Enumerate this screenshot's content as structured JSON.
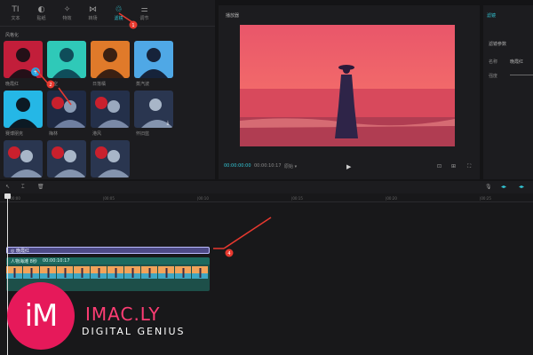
{
  "toolbar": {
    "tabs": [
      {
        "icon": "TI",
        "label": "文本"
      },
      {
        "icon": "◐",
        "label": "贴纸"
      },
      {
        "icon": "✧",
        "label": "特效"
      },
      {
        "icon": "⋈",
        "label": "转场"
      },
      {
        "icon": "♲",
        "label": "滤镜",
        "active": true
      },
      {
        "icon": "⚌",
        "label": "调节"
      }
    ]
  },
  "effects_panel": {
    "category": "风格化",
    "items": [
      {
        "label": "晚霞红"
      },
      {
        "label": "晴空"
      },
      {
        "label": "日落橘"
      },
      {
        "label": "蒸汽波"
      },
      {
        "label": "赛博朋克"
      },
      {
        "label": "梅林"
      },
      {
        "label": "港风"
      },
      {
        "label": "怀旧蓝"
      },
      {
        "label": ""
      },
      {
        "label": ""
      },
      {
        "label": ""
      }
    ]
  },
  "player": {
    "title": "播放器",
    "current_time": "00:00:00:00",
    "total_time": "00:00:10:17",
    "ratio": "原始 ▾"
  },
  "properties": {
    "tab": "滤镜",
    "section": "滤镜参数",
    "name_key": "名称",
    "name_value": "晚霞红",
    "intensity_key": "强度"
  },
  "timeline": {
    "ruler": [
      "|00:00",
      "|00:05",
      "|00:10",
      "|00:15",
      "|00:20",
      "|00:25"
    ],
    "effect_clip_label": "◎ 晚霞红",
    "video_label": "人物海滩 8秒",
    "video_duration": "00:00:10:17"
  },
  "annotations": [
    "1",
    "2",
    "4"
  ],
  "watermark": {
    "letters": "iM",
    "brand": "IMAC.LY",
    "tagline": "DIGITAL GENIUS"
  },
  "colors": {
    "accent": "#33c7d6",
    "effect_clip": "#4d4a86",
    "video_track": "#1d4f49",
    "annotation": "#e8392f",
    "watermark": "#e6195a"
  }
}
